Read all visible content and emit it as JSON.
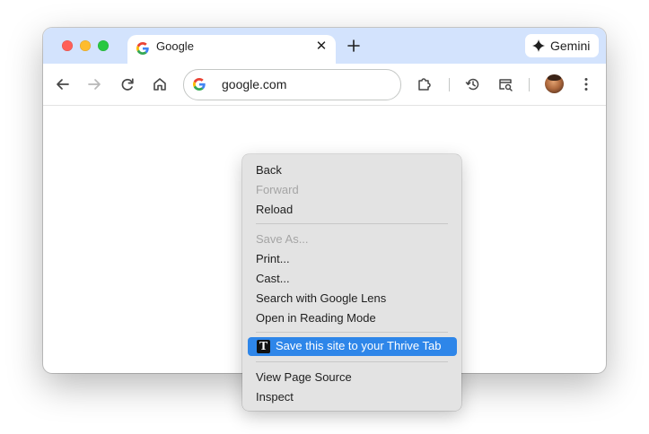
{
  "tab": {
    "title": "Google",
    "close_glyph": "✕",
    "favicon": "google-g-icon"
  },
  "titlebar": {
    "new_tab_icon": "plus-icon",
    "gemini_label": "Gemini",
    "gemini_icon": "sparkle-icon"
  },
  "toolbar": {
    "back_icon": "arrow-left-icon",
    "forward_icon": "arrow-right-icon",
    "reload_icon": "reload-icon",
    "home_icon": "home-icon",
    "omnibox_text": "google.com",
    "extensions_icon": "puzzle-icon",
    "history_icon": "history-icon",
    "tab_search_icon": "tab-search-icon",
    "menu_icon": "kebab-menu-icon"
  },
  "context_menu": {
    "back": "Back",
    "forward": "Forward",
    "reload": "Reload",
    "save_as": "Save As...",
    "print": "Print...",
    "cast": "Cast...",
    "search_lens": "Search with Google Lens",
    "reading_mode": "Open in Reading Mode",
    "thrive_icon_letter": "T",
    "thrive": "Save this site to your Thrive Tab",
    "view_source": "View Page Source",
    "inspect": "Inspect"
  },
  "colors": {
    "tabstrip": "#d3e3fd",
    "menu_bg": "#e3e3e3",
    "menu_highlight": "#2e86e9",
    "disabled_text": "#a5a5a5"
  }
}
